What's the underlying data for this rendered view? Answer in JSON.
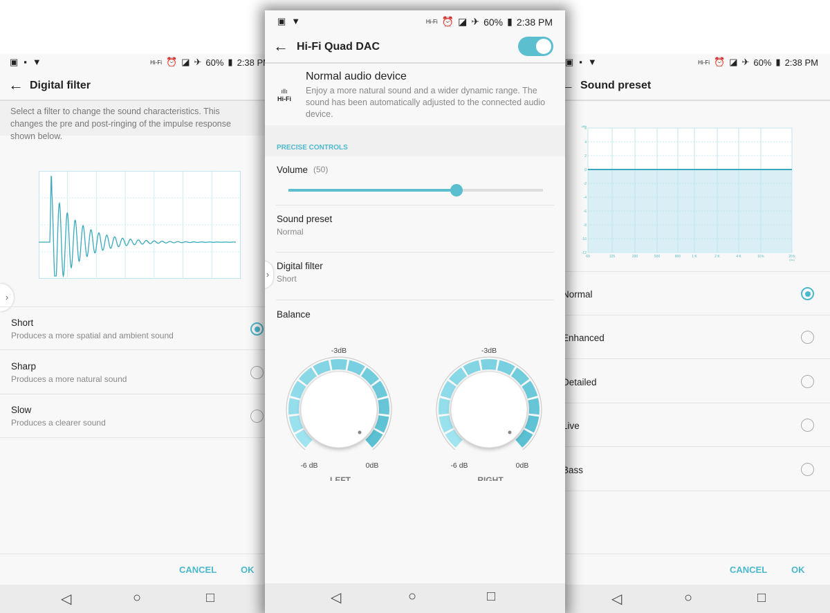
{
  "status": {
    "battery": "60%",
    "time": "2:38 PM",
    "hifi": "Hi-Fi"
  },
  "left": {
    "title": "Digital filter",
    "description": "Select a filter to change the sound characteristics. This changes the pre and post-ringing of the impulse response shown below.",
    "filters": [
      {
        "label": "Short",
        "sub": "Produces a more spatial and ambient sound",
        "selected": true
      },
      {
        "label": "Sharp",
        "sub": "Produces a more natural sound",
        "selected": false
      },
      {
        "label": "Slow",
        "sub": "Produces a clearer sound",
        "selected": false
      }
    ],
    "cancel": "CANCEL",
    "ok": "OK"
  },
  "mid": {
    "title": "Hi-Fi Quad DAC",
    "toggle_on": true,
    "device_title": "Normal audio device",
    "device_desc": "Enjoy a more natural sound and a wider dynamic range. The sound has been automatically adjusted to the connected audio device.",
    "section": "PRECISE CONTROLS",
    "volume_label": "Volume",
    "volume_value": "(50)",
    "volume_fraction": 0.66,
    "preset_label": "Sound preset",
    "preset_value": "Normal",
    "filter_label": "Digital filter",
    "filter_value": "Short",
    "balance_label": "Balance",
    "knobs": [
      {
        "name": "LEFT",
        "top": "-3dB",
        "min": "-6 dB",
        "max": "0dB"
      },
      {
        "name": "RIGHT",
        "top": "-3dB",
        "min": "-6 dB",
        "max": "0dB"
      }
    ]
  },
  "right": {
    "title": "Sound preset",
    "presets": [
      {
        "label": "Normal",
        "selected": true
      },
      {
        "label": "Enhanced",
        "selected": false
      },
      {
        "label": "Detailed",
        "selected": false
      },
      {
        "label": "Live",
        "selected": false
      },
      {
        "label": "Bass",
        "selected": false
      }
    ],
    "cancel": "CANCEL",
    "ok": "OK"
  },
  "colors": {
    "accent": "#4bb8cc",
    "fill": "#d9eff5"
  },
  "chart_data": {
    "type": "area",
    "ylabel": "(dB)",
    "xlabel": "(Hz)",
    "categories": [
      "60",
      "125",
      "200",
      "500",
      "800",
      "1 K",
      "2 K",
      "4 K",
      "10 k",
      "20 k"
    ],
    "values": [
      0,
      0,
      0,
      0,
      0,
      0,
      0,
      0,
      0,
      0
    ],
    "yticks": [
      6,
      4,
      2,
      0,
      -2,
      -4,
      -6,
      -8,
      -10,
      -12
    ],
    "ylim": [
      -12,
      6
    ],
    "grid": true
  }
}
